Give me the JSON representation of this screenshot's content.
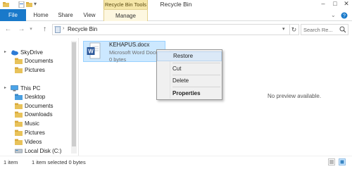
{
  "window": {
    "title": "Recycle Bin",
    "contextual_tab_group": "Recycle Bin Tools"
  },
  "ribbon": {
    "tabs": [
      "File",
      "Home",
      "Share",
      "View",
      "Manage"
    ]
  },
  "address": {
    "path": "Recycle Bin",
    "search_placeholder": "Search Re..."
  },
  "navpane": {
    "items": [
      {
        "label": "SkyDrive",
        "icon": "cloud-icon"
      },
      {
        "label": "Documents",
        "icon": "folder-icon"
      },
      {
        "label": "Pictures",
        "icon": "folder-icon"
      },
      {
        "label": "This PC",
        "icon": "computer-icon"
      },
      {
        "label": "Desktop",
        "icon": "folder-icon"
      },
      {
        "label": "Documents",
        "icon": "folder-icon"
      },
      {
        "label": "Downloads",
        "icon": "folder-icon"
      },
      {
        "label": "Music",
        "icon": "folder-icon"
      },
      {
        "label": "Pictures",
        "icon": "folder-icon"
      },
      {
        "label": "Videos",
        "icon": "folder-icon"
      },
      {
        "label": "Local Disk (C:)",
        "icon": "drive-icon"
      }
    ]
  },
  "file": {
    "name": "KEHAPUS.docx",
    "type": "Microsoft Word Docum...",
    "size": "0 bytes"
  },
  "context_menu": {
    "items": [
      "Restore",
      "Cut",
      "Delete",
      "Properties"
    ]
  },
  "preview": {
    "message": "No preview available."
  },
  "status": {
    "item_count": "1 item",
    "selection": "1 item selected  0 bytes"
  },
  "colors": {
    "accent": "#1979ca",
    "selection": "#cce8ff",
    "contextual_tab": "#f5e6a8"
  }
}
